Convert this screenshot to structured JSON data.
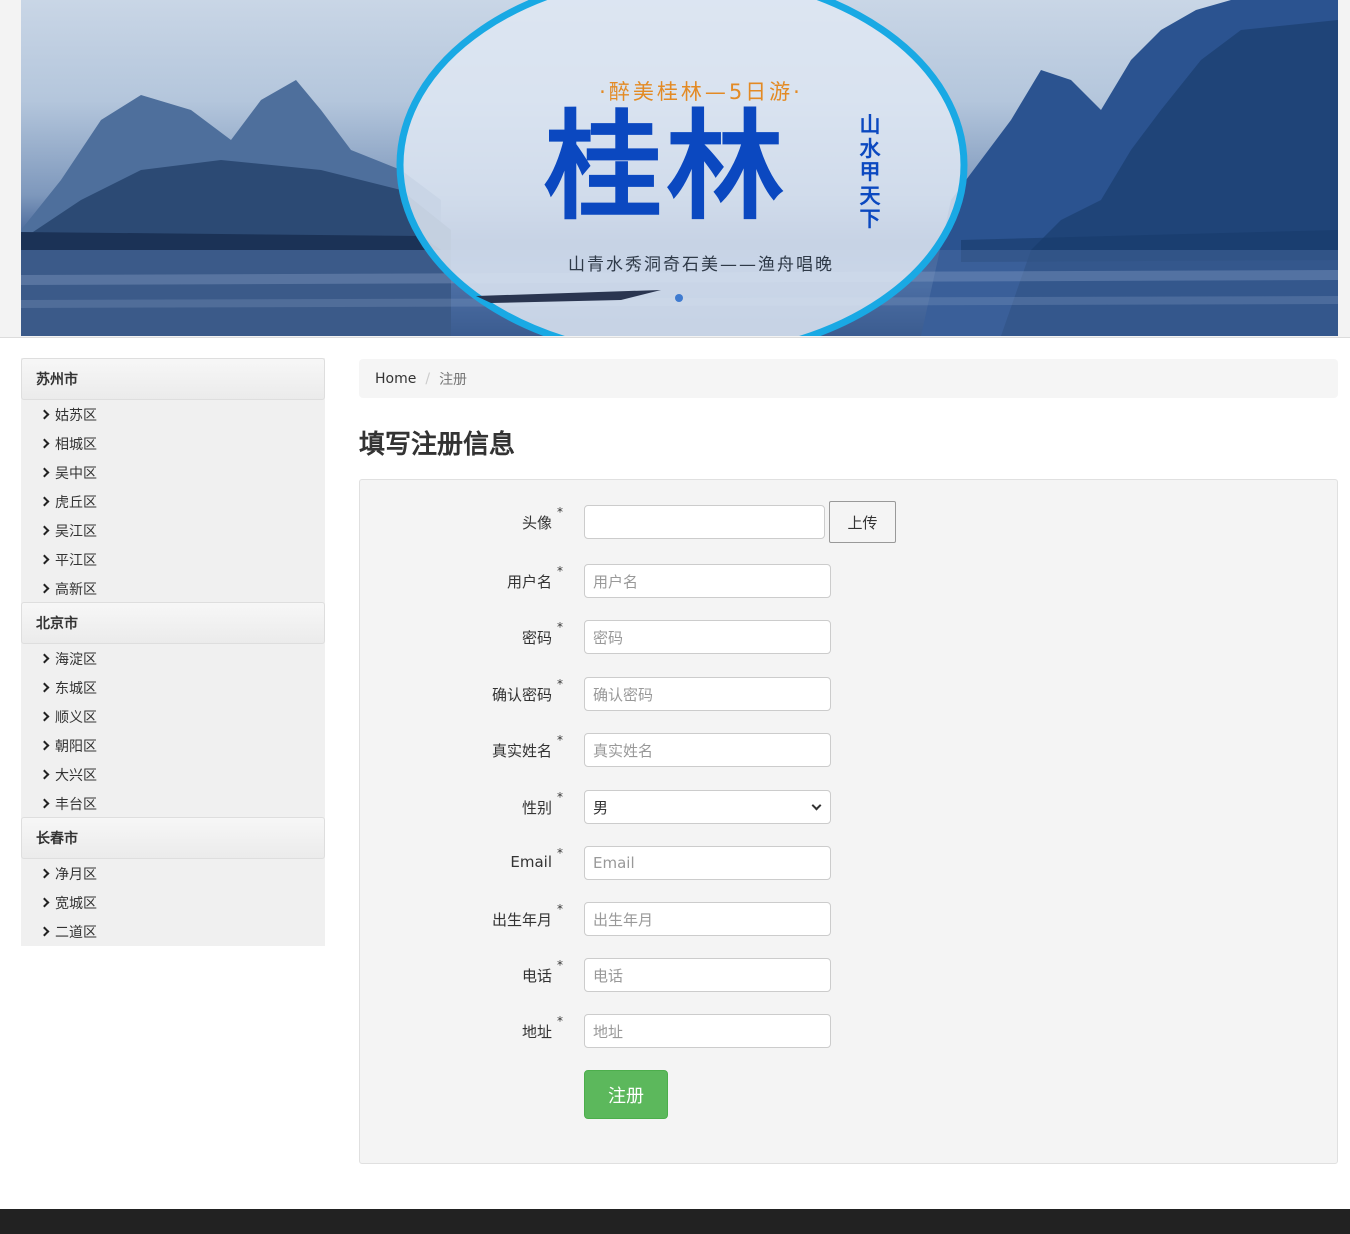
{
  "banner": {
    "slogan_top": "·醉美桂林—5日游·",
    "title": "桂林",
    "side_title": "山水甲天下",
    "slogan_bottom": "山青水秀洞奇石美——渔舟唱晚"
  },
  "sidebar": {
    "groups": [
      {
        "city": "苏州市",
        "districts": [
          "姑苏区",
          "相城区",
          "吴中区",
          "虎丘区",
          "吴江区",
          "平江区",
          "高新区"
        ]
      },
      {
        "city": "北京市",
        "districts": [
          "海淀区",
          "东城区",
          "顺义区",
          "朝阳区",
          "大兴区",
          "丰台区"
        ]
      },
      {
        "city": "长春市",
        "districts": [
          "净月区",
          "宽城区",
          "二道区"
        ]
      }
    ]
  },
  "breadcrumb": {
    "home": "Home",
    "separator": "/",
    "current": "注册"
  },
  "page_title": "填写注册信息",
  "form": {
    "required_mark": "*",
    "avatar": {
      "label": "头像",
      "value": "",
      "upload_label": "上传"
    },
    "username": {
      "label": "用户名",
      "placeholder": "用户名"
    },
    "password": {
      "label": "密码",
      "placeholder": "密码"
    },
    "confirm_password": {
      "label": "确认密码",
      "placeholder": "确认密码"
    },
    "real_name": {
      "label": "真实姓名",
      "placeholder": "真实姓名"
    },
    "gender": {
      "label": "性别",
      "selected": "男"
    },
    "email": {
      "label": "Email",
      "placeholder": "Email"
    },
    "birth": {
      "label": "出生年月",
      "placeholder": "出生年月"
    },
    "phone": {
      "label": "电话",
      "placeholder": "电话"
    },
    "address": {
      "label": "地址",
      "placeholder": "地址"
    },
    "submit_label": "注册"
  },
  "colors": {
    "primary_button": "#5cb85c",
    "banner_title": "#0b48c0",
    "footer": "#222222"
  }
}
